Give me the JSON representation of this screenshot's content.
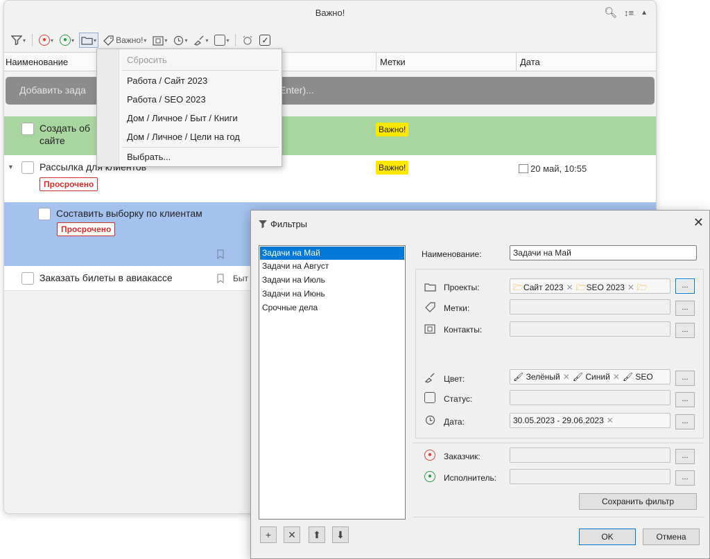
{
  "window": {
    "title": "Важно!"
  },
  "toolbar": {
    "tag_label": "Важно!"
  },
  "columns": {
    "name": "Наименование",
    "tags": "Метки",
    "date": "Дата"
  },
  "add_task": {
    "text_left": "Добавить зада",
    "text_right": "Enter)..."
  },
  "tasks": [
    {
      "title_line1": "Создать об",
      "title_line2": "сайте",
      "tag": "Важно!"
    },
    {
      "title": "Рассылка для клиентов",
      "overdue": "Просрочено",
      "tag": "Важно!",
      "date": "20 май, 10:55"
    },
    {
      "title": "Составить выборку по клиентам",
      "overdue": "Просрочено"
    },
    {
      "title": "Заказать билеты в авиакассе",
      "extra": "Быт"
    }
  ],
  "project_menu": {
    "items": [
      {
        "label": "Сбросить"
      },
      {
        "label": "Работа / Сайт 2023"
      },
      {
        "label": "Работа / SEO 2023"
      },
      {
        "label": "Дом / Личное / Быт / Книги"
      },
      {
        "label": "Дом / Личное / Цели на год"
      },
      {
        "label": "Выбрать..."
      }
    ]
  },
  "filters_dialog": {
    "title": "Фильтры",
    "filters": [
      "Задачи на Май",
      "Задачи на Август",
      "Задачи на Июль",
      "Задачи на Июнь",
      "Срочные дела"
    ],
    "selected_filter": "Задачи на Май",
    "name_label": "Наименование:",
    "name_value": "Задачи на Май",
    "projects_label": "Проекты:",
    "projects_value": [
      "Сайт 2023",
      "SEO 2023"
    ],
    "tags_label": "Метки:",
    "contacts_label": "Контакты:",
    "color_label": "Цвет:",
    "color_value": [
      "Зелёный",
      "Синий",
      "SEO"
    ],
    "status_label": "Статус:",
    "date_label": "Дата:",
    "date_value": "30.05.2023 - 29.06.2023",
    "customer_label": "Заказчик:",
    "executor_label": "Исполнитель:",
    "ellipsis": "...",
    "save_label": "Сохранить фильтр",
    "ok_label": "OK",
    "cancel_label": "Отмена"
  },
  "colors": {
    "green_row": "#a9d5a0",
    "blue_row": "#a5c2ee",
    "important_badge": "#ffe800",
    "overdue": "#d32f2f",
    "selection": "#0078d7"
  }
}
